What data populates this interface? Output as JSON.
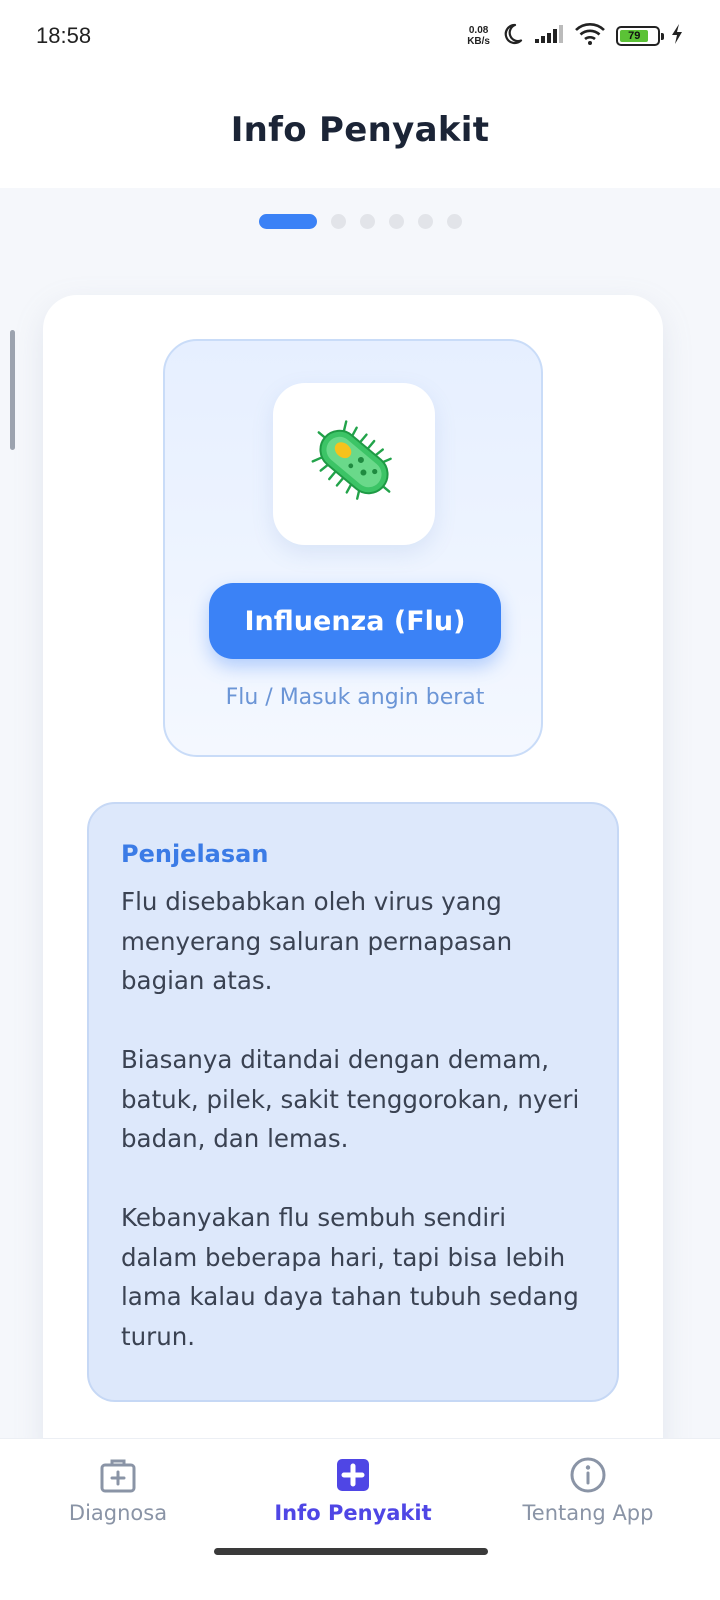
{
  "status_bar": {
    "time": "18:58",
    "net_speed_value": "0.08",
    "net_speed_unit": "KB/s",
    "battery_level": "79",
    "icons": [
      "moon-icon",
      "signal-icon",
      "wifi-icon",
      "battery-icon",
      "charging-icon"
    ]
  },
  "header": {
    "title": "Info Penyakit"
  },
  "pager": {
    "total": 6,
    "active_index": 0
  },
  "disease": {
    "icon": "bacteria-icon",
    "name": "Influenza (Flu)",
    "alias": "Flu / Masuk angin berat"
  },
  "explanation": {
    "title": "Penjelasan",
    "paragraphs": [
      "Flu disebabkan oleh virus yang menyerang saluran pernapasan bagian atas.",
      "Biasanya ditandai dengan demam, batuk, pilek, sakit tenggorokan, nyeri badan, dan lemas.",
      "Kebanyakan flu sembuh sendiri dalam beberapa hari, tapi bisa lebih lama kalau daya tahan tubuh sedang turun."
    ]
  },
  "bottom_nav": {
    "items": [
      {
        "label": "Diagnosa",
        "icon": "medical-kit-icon",
        "active": false
      },
      {
        "label": "Info Penyakit",
        "icon": "medical-cross-icon",
        "active": true
      },
      {
        "label": "Tentang App",
        "icon": "info-icon",
        "active": false
      }
    ]
  },
  "colors": {
    "accent": "#3b82f6",
    "nav_active": "#4f46e5",
    "nav_inactive": "#8a94a6",
    "panel_bg": "#dde8fb"
  }
}
